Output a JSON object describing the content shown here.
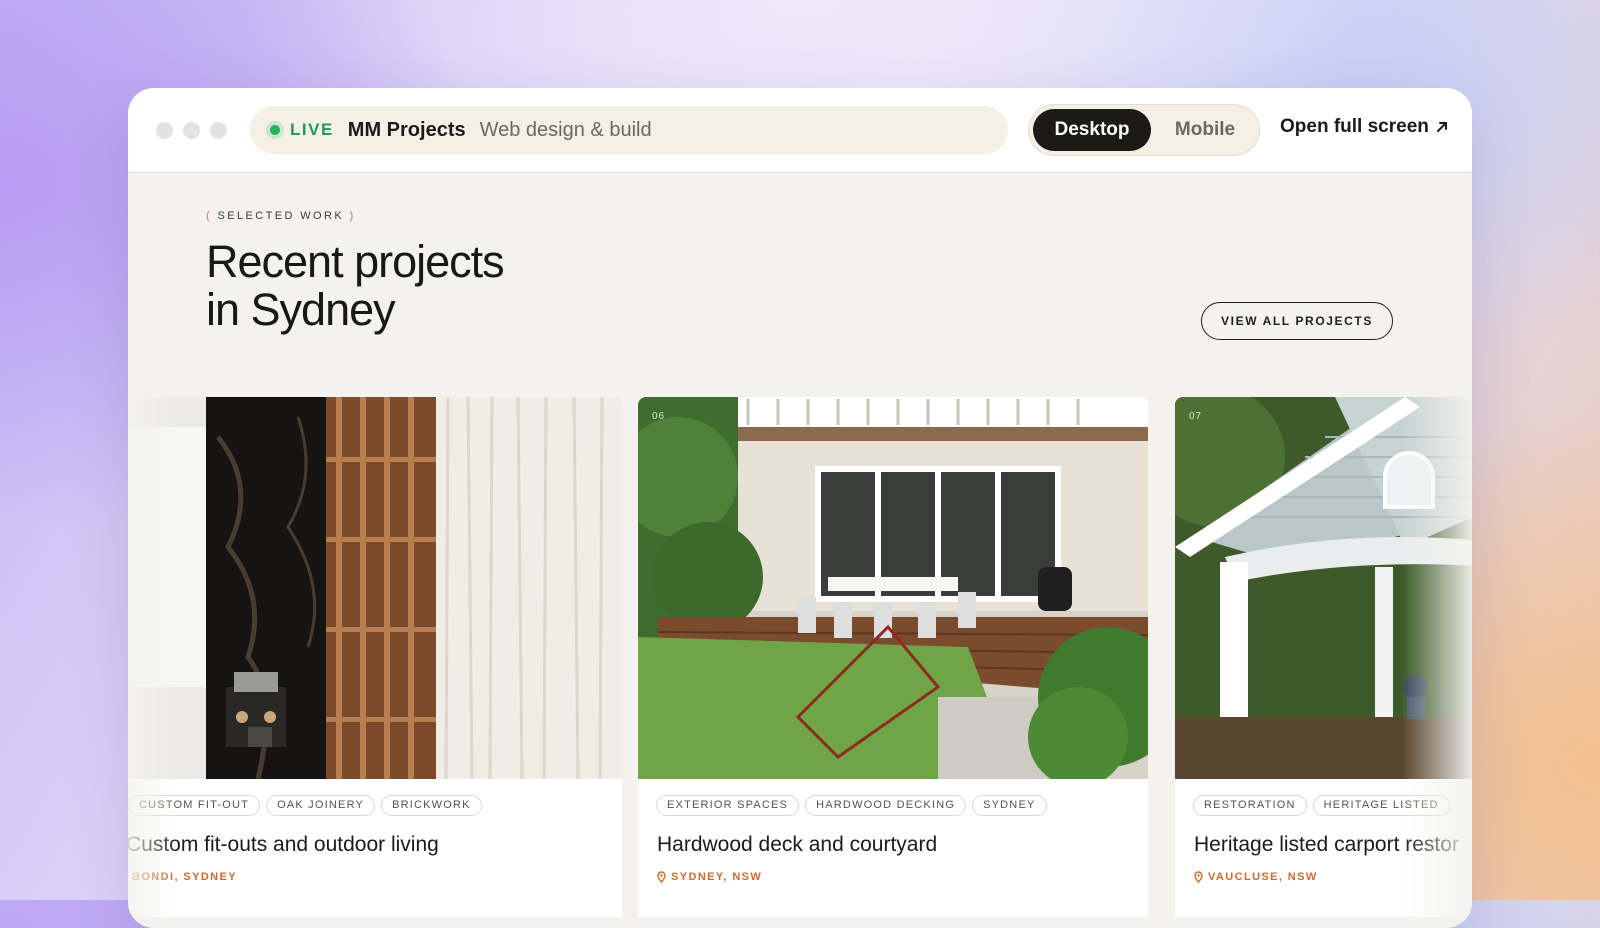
{
  "topbar": {
    "live_label": "LIVE",
    "site_name": "MM Projects",
    "site_subtitle": "Web design & build",
    "view_modes": [
      "Desktop",
      "Mobile"
    ],
    "active_view": "Desktop",
    "fullscreen_label": "Open full screen"
  },
  "section": {
    "eyebrow_open": "(",
    "eyebrow": "SELECTED WORK",
    "eyebrow_close": ")",
    "heading_line1": "Recent projects",
    "heading_line2": "in Sydney",
    "view_all_label": "VIEW ALL PROJECTS"
  },
  "projects": [
    {
      "tags": [
        "CUSTOM FIT-OUT",
        "OAK JOINERY",
        "BRICKWORK"
      ],
      "title": "Custom fit-outs and outdoor living",
      "location": "BONDI, SYDNEY"
    },
    {
      "number": "06",
      "tags": [
        "EXTERIOR SPACES",
        "HARDWOOD DECKING",
        "SYDNEY"
      ],
      "title": "Hardwood deck and courtyard",
      "location": "SYDNEY, NSW"
    },
    {
      "number": "07",
      "tags": [
        "RESTORATION",
        "HERITAGE LISTED"
      ],
      "title": "Heritage listed carport restor",
      "location": "VAUCLUSE, NSW"
    }
  ],
  "colors": {
    "live_green": "#22b35e",
    "accent_orange": "#d2692c",
    "dark": "#1b1a17"
  }
}
